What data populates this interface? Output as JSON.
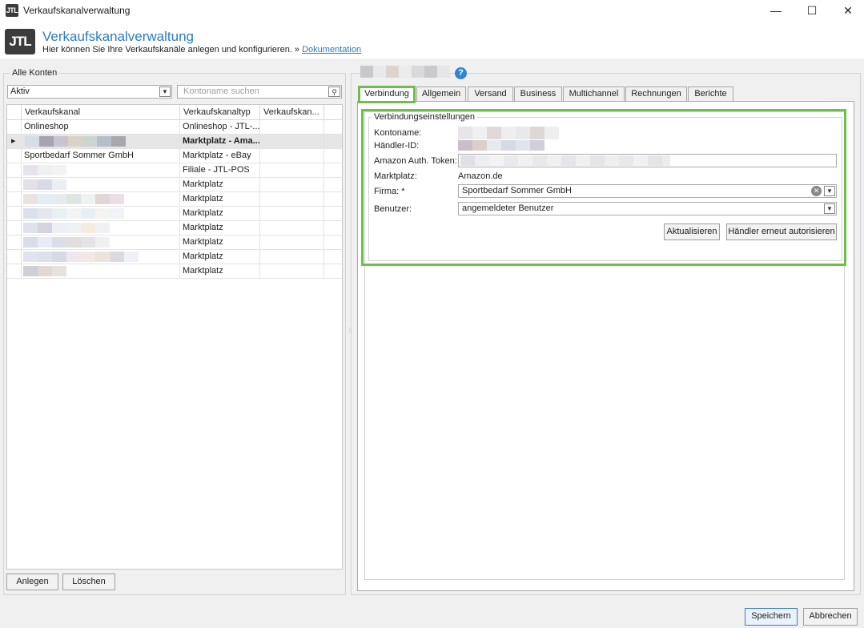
{
  "window": {
    "title": "Verkaufskanalverwaltung",
    "app_icon": "JTL",
    "controls": {
      "minimize": "—",
      "maximize": "☐",
      "close": "✕"
    }
  },
  "header": {
    "logo": "JTL",
    "title": "Verkaufskanalverwaltung",
    "subtitle": "Hier können Sie Ihre Verkaufskanäle anlegen und konfigurieren. »",
    "doc_link": "Dokumentation"
  },
  "left": {
    "group_label": "Alle Konten",
    "filter": {
      "value": "Aktiv",
      "icon": "chevron-down-icon"
    },
    "search": {
      "placeholder": "Kontoname suchen",
      "icon": "search-icon"
    },
    "columns": [
      "Verkaufskanal",
      "Verkaufskanaltyp",
      "Verkaufskan..."
    ],
    "rows": [
      {
        "name": "Onlineshop",
        "type": "Onlineshop - JTL-..."
      },
      {
        "name": "",
        "type": "Marktplatz - Ama...",
        "selected": true
      },
      {
        "name": "Sportbedarf Sommer GmbH",
        "type": "Marktplatz - eBay"
      },
      {
        "name": "",
        "type": "Filiale - JTL-POS"
      },
      {
        "name": "",
        "type": "Marktplatz"
      },
      {
        "name": "",
        "type": "Marktplatz"
      },
      {
        "name": "",
        "type": "Marktplatz"
      },
      {
        "name": "",
        "type": "Marktplatz"
      },
      {
        "name": "",
        "type": "Marktplatz"
      },
      {
        "name": "",
        "type": "Marktplatz"
      },
      {
        "name": "",
        "type": "Marktplatz"
      }
    ],
    "buttons": {
      "add": "Anlegen",
      "delete": "Löschen"
    }
  },
  "right": {
    "tabs": [
      "Verbindung",
      "Allgemein",
      "Versand",
      "Business",
      "Multichannel",
      "Rechnungen",
      "Berichte"
    ],
    "active_tab": "Verbindung",
    "connection": {
      "group_label": "Verbindungseinstellungen",
      "labels": {
        "account": "Kontoname:",
        "merchant": "Händler-ID:",
        "token": "Amazon Auth. Token:",
        "marketplace": "Marktplatz:",
        "company": "Firma: *",
        "user": "Benutzer:"
      },
      "values": {
        "marketplace": "Amazon.de",
        "company": "Sportbedarf Sommer GmbH",
        "user": "angemeldeter Benutzer"
      },
      "buttons": {
        "refresh": "Aktualisieren",
        "reauth": "Händler erneut autorisieren"
      }
    }
  },
  "footer": {
    "save": "Speichern",
    "cancel": "Abbrechen"
  },
  "colors": {
    "accent": "#2d7dbd",
    "highlight": "#6cc04a",
    "selected_row": "#e6e6e6"
  }
}
